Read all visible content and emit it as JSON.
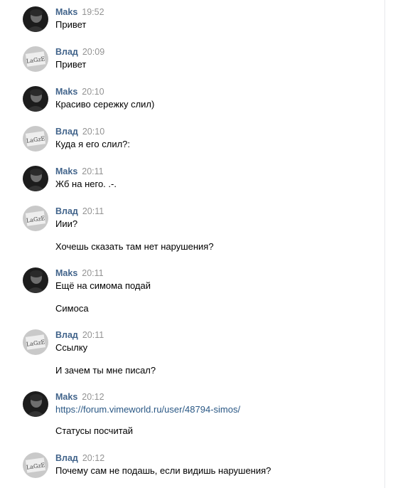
{
  "messages": [
    {
      "author": "Maks",
      "time": "19:52",
      "avatar": "maks-avatar",
      "lines": [
        "Привет"
      ]
    },
    {
      "author": "Влад",
      "time": "20:09",
      "avatar": "vlad-avatar",
      "lines": [
        "Привет"
      ]
    },
    {
      "author": "Maks",
      "time": "20:10",
      "avatar": "maks-avatar",
      "lines": [
        "Красиво сережку слил)"
      ]
    },
    {
      "author": "Влад",
      "time": "20:10",
      "avatar": "vlad-avatar",
      "lines": [
        "Куда я его слил?:"
      ]
    },
    {
      "author": "Maks",
      "time": "20:11",
      "avatar": "maks-avatar",
      "lines": [
        "Жб на него. .-."
      ]
    },
    {
      "author": "Влад",
      "time": "20:11",
      "avatar": "vlad-avatar",
      "lines": [
        "Иии?",
        "Хочешь сказать там нет нарушения?"
      ]
    },
    {
      "author": "Maks",
      "time": "20:11",
      "avatar": "maks-avatar",
      "lines": [
        "Ещё на симома подай",
        "Симоса"
      ]
    },
    {
      "author": "Влад",
      "time": "20:11",
      "avatar": "vlad-avatar",
      "lines": [
        "Ссылку",
        "И зачем ты мне писал?"
      ]
    },
    {
      "author": "Maks",
      "time": "20:12",
      "avatar": "maks-avatar",
      "lines": [
        "https://forum.vimeworld.ru/user/48794-simos/",
        "Статусы посчитай"
      ]
    },
    {
      "author": "Влад",
      "time": "20:12",
      "avatar": "vlad-avatar",
      "lines": [
        "Почему сам не подашь, если видишь нарушения?"
      ]
    }
  ],
  "vlad_avatar_text": "LaGzE",
  "colors": {
    "author": "#42648b",
    "time": "#939393",
    "link": "#2a5885",
    "text": "#000000"
  }
}
